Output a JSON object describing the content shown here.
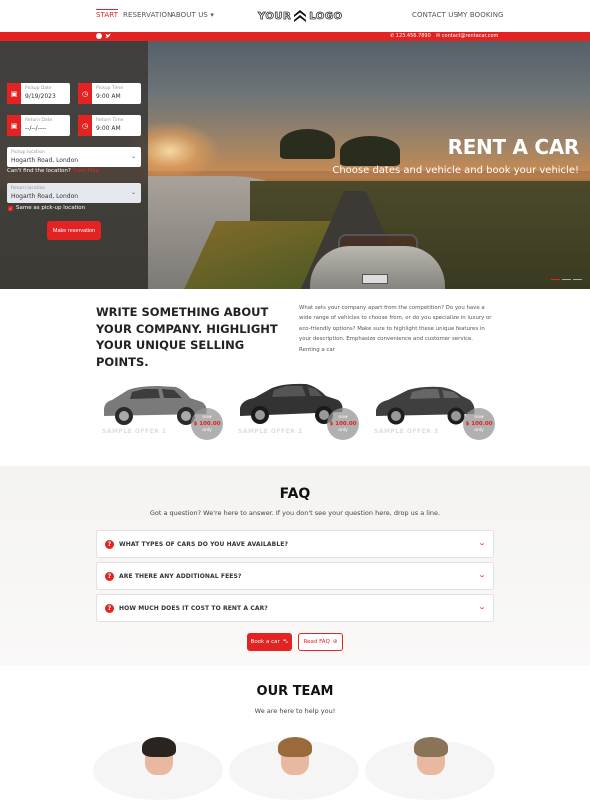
{
  "nav": {
    "left": [
      "START",
      "RESERVATION",
      "ABOUT US"
    ],
    "about_caret": "▾",
    "logo_left": "YOUR",
    "logo_right": "LOGO",
    "right": [
      "CONTACT US",
      "MY BOOKING"
    ]
  },
  "topbar": {
    "social": [
      "instagram-icon",
      "twitter-icon"
    ],
    "phone": "123.456.7890",
    "email": "contact@rentacar.com"
  },
  "hero": {
    "title": "RENT A CAR",
    "subtitle": "Choose dates and vehicle and book your vehicle!",
    "slides": 3,
    "active_slide": 1
  },
  "booking": {
    "pickup_date": {
      "label": "Pickup Date",
      "value": "9/19/2023"
    },
    "pickup_time": {
      "label": "Pickup Time",
      "value": "9:00 AM"
    },
    "return_date": {
      "label": "Return Date",
      "value": "--/--/----"
    },
    "return_time": {
      "label": "Return Time",
      "value": "9:00 AM"
    },
    "pickup_location": {
      "label": "Pickup location",
      "value": "Hogarth Road, London"
    },
    "cant_find": "Can't find the location?",
    "view_map": "View Map",
    "return_location": {
      "label": "Return location",
      "value": "Hogarth Road, London"
    },
    "same_as_pickup": "Same as pick-up location",
    "same_checked": true,
    "submit": "Make reservation"
  },
  "about": {
    "heading": "WRITE SOMETHING ABOUT YOUR COMPANY. HIGHLIGHT YOUR UNIQUE SELLING POINTS.",
    "text": "What sets your company apart from the competition? Do you have a wide range of vehicles to choose from, or do you specialize in luxury or eco-friendly options? Make sure to highlight these unique features in your description. Emphasize convenience and customer service. Renting a car"
  },
  "cars": [
    {
      "name": "SAMPLE OFFER 1",
      "now": "now",
      "price": "$ 100.00",
      "only": "only"
    },
    {
      "name": "SAMPLE OFFER 2",
      "now": "now",
      "price": "$ 100.00",
      "only": "only"
    },
    {
      "name": "SAMPLE OFFER 3",
      "now": "now",
      "price": "$ 100.00",
      "only": "only"
    }
  ],
  "faq": {
    "title": "FAQ",
    "subtitle": "Got a question? We're here to answer. If you don't see your question here, drop us a line.",
    "items": [
      "WHAT TYPES OF CARS DO YOU HAVE AVAILABLE?",
      "ARE THERE ANY ADDITIONAL FEES?",
      "HOW MUCH DOES IT COST TO RENT A CAR?"
    ],
    "book_button": "Book a car",
    "read_button": "Read FAQ"
  },
  "team": {
    "title": "OUR TEAM",
    "subtitle": "We are here to help you!"
  },
  "colors": {
    "accent": "#e32222"
  }
}
